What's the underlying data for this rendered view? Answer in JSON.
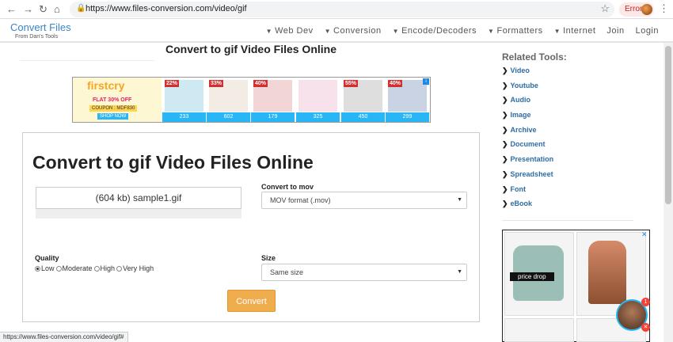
{
  "browser": {
    "url": "https://www.files-conversion.com/video/gif",
    "error_label": "Error",
    "status_url": "https://www.files-conversion.com/video/gif#"
  },
  "site": {
    "logo": "Convert Files",
    "logo_sub": "From Dan's Tools",
    "nav": [
      "Web Dev",
      "Conversion",
      "Encode/Decoders",
      "Formatters",
      "Internet",
      "Join",
      "Login"
    ]
  },
  "main": {
    "page_title": "Convert to gif Video Files Online",
    "panel_title": "Convert to gif Video Files Online",
    "file_label": "(604 kb) sample1.gif",
    "convert_to_label": "Convert to mov",
    "convert_to_value": "MOV format (.mov)",
    "quality_label": "Quality",
    "quality_options": [
      "Low",
      "Moderate",
      "High",
      "Very High"
    ],
    "quality_selected": "Low",
    "size_label": "Size",
    "size_value": "Same size",
    "convert_button": "Convert"
  },
  "ad_banner": {
    "brand": "firstcry",
    "flat_text": "FLAT 30% OFF",
    "coupon": "COUPON : MDF830",
    "shop_now": "SHOP NOW",
    "tiles": [
      {
        "badge": "22%",
        "price": "233"
      },
      {
        "badge": "33%",
        "price": "602"
      },
      {
        "badge": "40%",
        "price": "179"
      },
      {
        "badge": "",
        "price": "325"
      },
      {
        "badge": "55%",
        "price": "450"
      },
      {
        "badge": "40%",
        "price": "299"
      }
    ]
  },
  "sidebar": {
    "title": "Related Tools:",
    "items": [
      "Video",
      "Youtube",
      "Audio",
      "Image",
      "Archive",
      "Document",
      "Presentation",
      "Spreadsheet",
      "Font",
      "eBook"
    ]
  },
  "side_ad": {
    "label": "price drop"
  },
  "chat": {
    "badge": "1"
  }
}
